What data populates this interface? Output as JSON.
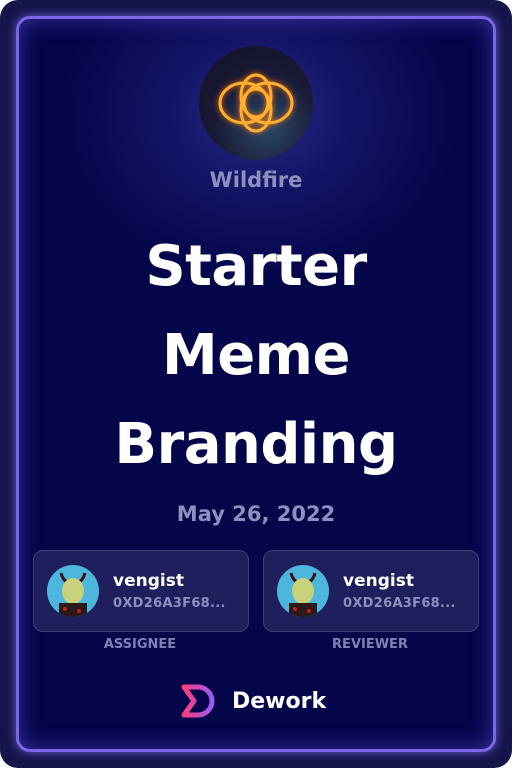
{
  "organization": {
    "name": "Wildfire",
    "logo_icon": "glowing-interlocked-rings-logo"
  },
  "task": {
    "title_lines": [
      "Starter",
      "Meme",
      "Branding"
    ],
    "date": "May 26, 2022"
  },
  "people": [
    {
      "name": "vengist",
      "address": "0XD26A3F68...",
      "role": "ASSIGNEE",
      "avatar_icon": "ape-avatar"
    },
    {
      "name": "vengist",
      "address": "0XD26A3F68...",
      "role": "REVIEWER",
      "avatar_icon": "ape-avatar"
    }
  ],
  "brand": {
    "name": "Dework",
    "logo_icon": "dework-logo"
  },
  "colors": {
    "border": "#7a68e6",
    "background": "#05054a",
    "muted_text": "#8d90bf"
  }
}
